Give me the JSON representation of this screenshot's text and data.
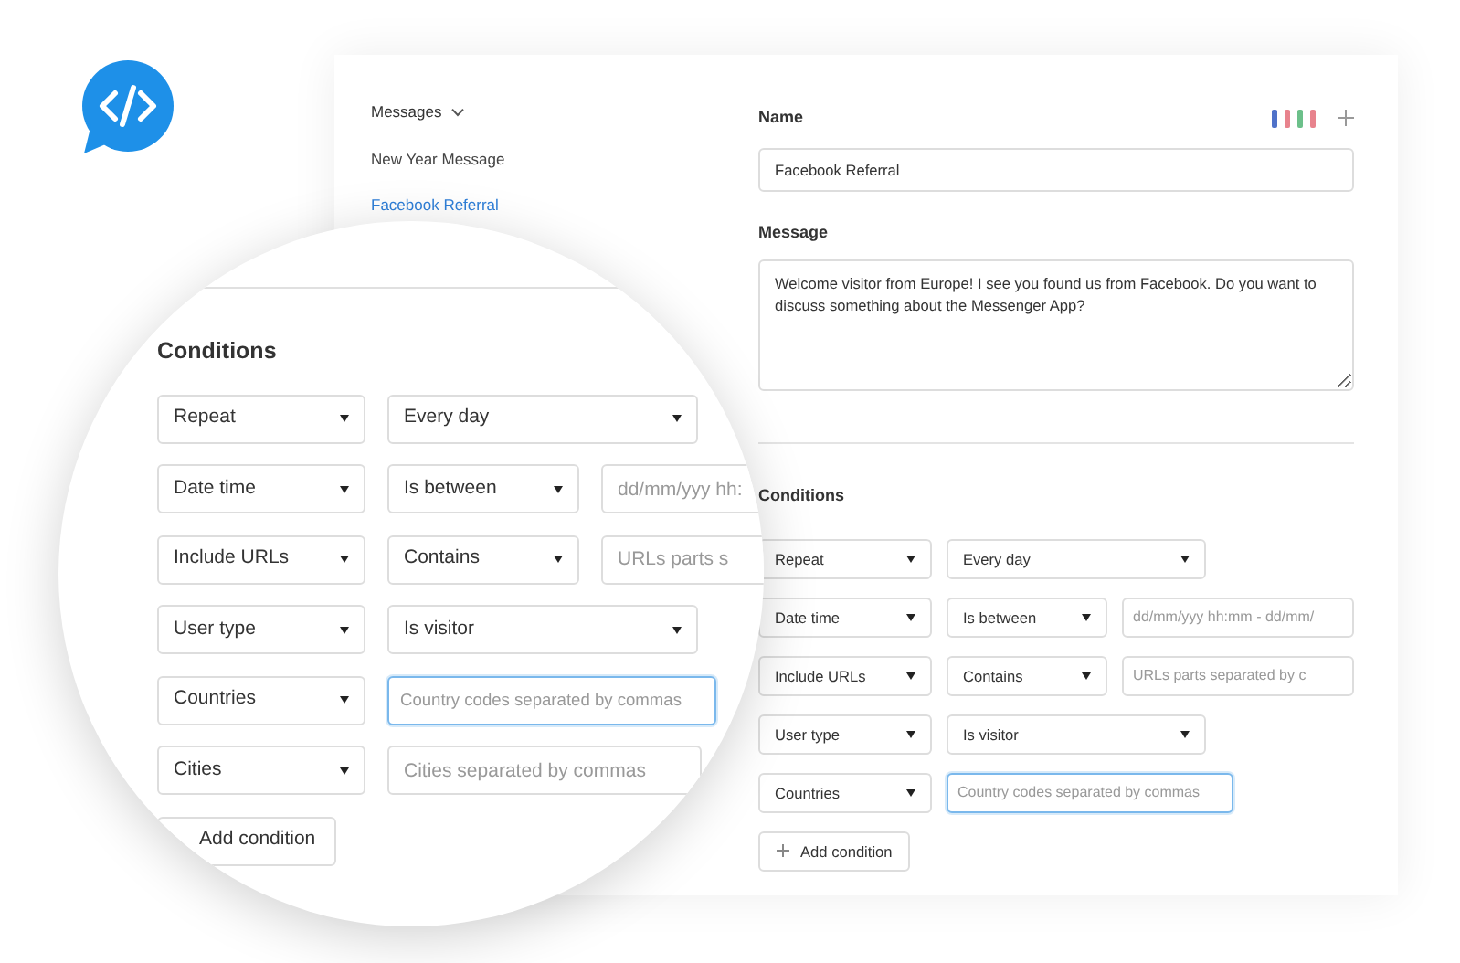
{
  "sidebar": {
    "header": "Messages",
    "items": [
      {
        "label": "New Year Message",
        "selected": false
      },
      {
        "label": "Facebook Referral",
        "selected": true
      }
    ]
  },
  "languages": [
    {
      "kind": "fr"
    },
    {
      "kind": "it"
    }
  ],
  "name_field": {
    "label": "Name",
    "value": "Facebook Referral"
  },
  "message_field": {
    "label": "Message",
    "value": "Welcome visitor from Europe! I see you found us from Facebook. Do you want to discuss something about the Messenger App?"
  },
  "conditions": {
    "title": "Conditions",
    "rows": [
      {
        "field": "Repeat",
        "operator": "Every day"
      },
      {
        "field": "Date time",
        "operator": "Is between",
        "input": {
          "placeholder": "dd/mm/yyy hh:mm - dd/mm/",
          "focused": false
        }
      },
      {
        "field": "Include URLs",
        "operator": "Contains",
        "input": {
          "placeholder": "URLs parts separated by c",
          "focused": false
        }
      },
      {
        "field": "User type",
        "operator": "Is visitor"
      },
      {
        "field": "Countries",
        "input": {
          "placeholder": "Country codes separated by commas",
          "focused": true
        }
      }
    ],
    "add_button": "Add condition"
  },
  "magnifier": {
    "title": "Conditions",
    "rows": [
      {
        "field": "Repeat",
        "operator": "Every day"
      },
      {
        "field": "Date time",
        "operator": "Is between",
        "input": {
          "placeholder": "dd/mm/yyy hh:",
          "focused": false
        }
      },
      {
        "field": "Include URLs",
        "operator": "Contains",
        "input": {
          "placeholder": "URLs parts s",
          "focused": false
        }
      },
      {
        "field": "User type",
        "operator": "Is visitor"
      },
      {
        "field": "Countries",
        "input": {
          "placeholder": "Country codes separated by commas",
          "focused": true
        }
      },
      {
        "field": "Cities",
        "input": {
          "placeholder": "Cities separated by commas",
          "focused": false
        }
      }
    ],
    "add_button": "Add condition"
  }
}
